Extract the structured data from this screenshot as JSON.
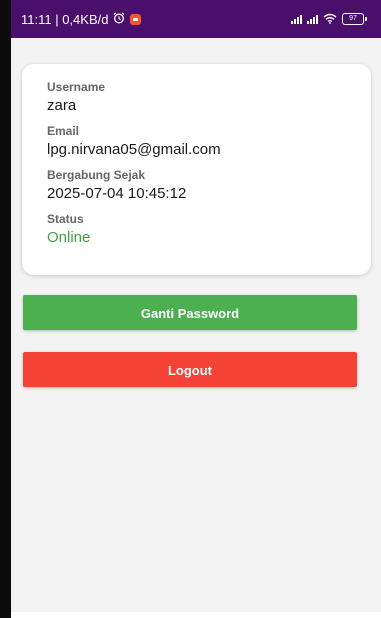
{
  "status_bar": {
    "time_info": "11:11 | 0,4KB/d",
    "alarm_icon": "alarm-clock-icon",
    "notif_icon": "app-notification-icon",
    "battery_level": "97",
    "background_color": "#4a0f6b"
  },
  "profile": {
    "username_label": "Username",
    "username_value": "zara",
    "email_label": "Email",
    "email_value": "lpg.nirvana05@gmail.com",
    "joined_label": "Bergabung Sejak",
    "joined_value": "2025-07-04 10:45:12",
    "status_label": "Status",
    "status_value": "Online",
    "status_color": "#43a047"
  },
  "actions": {
    "change_password_label": "Ganti Password",
    "change_password_color": "#4caf50",
    "logout_label": "Logout",
    "logout_color": "#f44336"
  }
}
